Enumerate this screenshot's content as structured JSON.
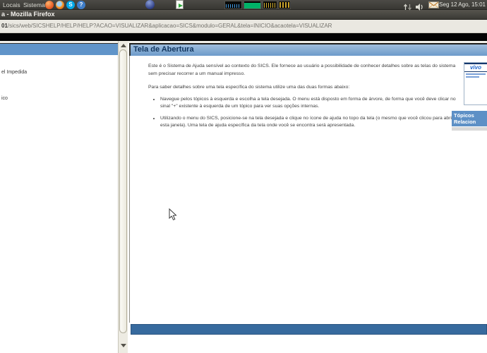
{
  "desktop_panel": {
    "menu_locais": "Locais",
    "menu_sistema": "Sistema",
    "skype_letter": "S",
    "help_mark": "?",
    "clock": "Seg 12 Ago, 15:01"
  },
  "window": {
    "title": "a - Mozilla Firefox",
    "url_host": "01",
    "url_path": "/sics/web/SICSHELP/HELP/HELP?ACAO=VISUALIZAR&aplicacao=SICS&modulo=GERAL&tela=INICIO&acaotela=VISUALIZAR"
  },
  "sidebar": {
    "items": [
      {
        "label": "el Impedida"
      },
      {
        "label": "ico"
      }
    ]
  },
  "content": {
    "title": "Tela de Abertura",
    "intro": "Este é o Sistema de Ajuda sensível ao contexto do SICS. Ele fornece ao usuário a possibilidade de conhecer detalhes sobre as telas do sistema sem precisar recorrer a um manual impresso.",
    "subtitle": "Para saber detalhes sobre uma tela específica do sistema utilize uma das duas formas abaixo:",
    "bullets": [
      "Navegue pelos tópicos à esquerda e escolha a tela desejada. O menu está disposto em forma de árvore, de forma que você deve clicar no sinal \"+\" existente à esquerda de um tópico para ver suas opções internas.",
      "Utilizando o menu do SICS, posicione-se na tela desejada e clique no ícone de ajuda no topo da tela (o mesmo que você clicou para abrir esta janela). Uma tela de ajuda específica da tela onde você se encontra será apresentada."
    ],
    "ad": {
      "brand": "vivo"
    },
    "related": {
      "line1": "Tópicos",
      "line2": "Relacion"
    }
  },
  "colors": {
    "frame_header_blue": "#6094c9",
    "content_title_text": "#12365f",
    "footer_blue": "#376a9e",
    "panel_dark": "#3f3e3a",
    "related_box_blue": "#5d90c6",
    "ad_brand_blue": "#1f66cc"
  }
}
